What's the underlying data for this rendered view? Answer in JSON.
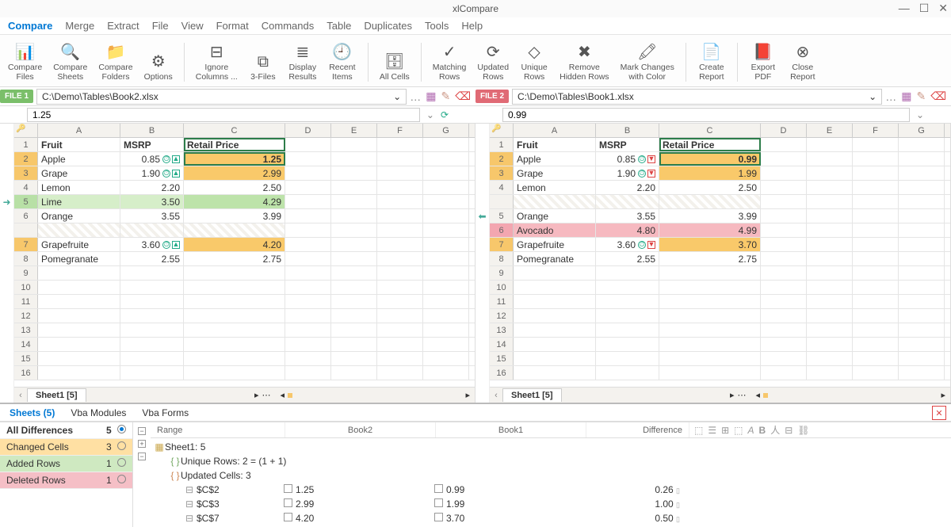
{
  "app": {
    "title": "xlCompare"
  },
  "menu": [
    "Compare",
    "Merge",
    "Extract",
    "File",
    "View",
    "Format",
    "Commands",
    "Table",
    "Duplicates",
    "Tools",
    "Help"
  ],
  "ribbon": [
    {
      "l1": "Compare",
      "l2": "Files"
    },
    {
      "l1": "Compare",
      "l2": "Sheets"
    },
    {
      "l1": "Compare",
      "l2": "Folders"
    },
    {
      "l1": "Options",
      "l2": ""
    },
    {
      "l1": "Ignore",
      "l2": "Columns ..."
    },
    {
      "l1": "3-Files",
      "l2": ""
    },
    {
      "l1": "Display",
      "l2": "Results"
    },
    {
      "l1": "Recent",
      "l2": "Items"
    },
    {
      "l1": "All Cells",
      "l2": ""
    },
    {
      "l1": "Matching",
      "l2": "Rows"
    },
    {
      "l1": "Updated",
      "l2": "Rows"
    },
    {
      "l1": "Unique",
      "l2": "Rows"
    },
    {
      "l1": "Remove",
      "l2": "Hidden Rows"
    },
    {
      "l1": "Mark Changes",
      "l2": "with Color"
    },
    {
      "l1": "Create",
      "l2": "Report"
    },
    {
      "l1": "Export",
      "l2": "PDF"
    },
    {
      "l1": "Close",
      "l2": "Report"
    }
  ],
  "files": {
    "left": {
      "badge": "FILE 1",
      "color": "#7bbf6a",
      "path": "C:\\Demo\\Tables\\Book2.xlsx",
      "formula": "1.25"
    },
    "right": {
      "badge": "FILE 2",
      "color": "#e06a75",
      "path": "C:\\Demo\\Tables\\Book1.xlsx",
      "formula": "0.99"
    }
  },
  "cols": [
    "A",
    "B",
    "C",
    "D",
    "E",
    "F",
    "G"
  ],
  "headers": [
    "Fruit",
    "MSRP",
    "Retail Price"
  ],
  "left_rows": [
    {
      "n": "1",
      "hdr": true
    },
    {
      "n": "2",
      "a": "Apple",
      "b": "0.85",
      "c": "1.25",
      "cls": "amber",
      "ind": "up",
      "sel": true
    },
    {
      "n": "3",
      "a": "Grape",
      "b": "1.90",
      "c": "2.99",
      "cls": "amber",
      "ind": "up"
    },
    {
      "n": "4",
      "a": "Lemon",
      "b": "2.20",
      "c": "2.50"
    },
    {
      "n": "5",
      "a": "Lime",
      "b": "3.50",
      "c": "4.29",
      "cls": "green"
    },
    {
      "n": "6",
      "a": "Orange",
      "b": "3.55",
      "c": "3.99"
    },
    {
      "n": "",
      "dash": true
    },
    {
      "n": "7",
      "a": "Grapefruite",
      "b": "3.60",
      "c": "4.20",
      "cls": "amber",
      "ind": "up"
    },
    {
      "n": "8",
      "a": "Pomegranate",
      "b": "2.55",
      "c": "2.75"
    },
    {
      "n": "9"
    },
    {
      "n": "10"
    },
    {
      "n": "11"
    },
    {
      "n": "12"
    },
    {
      "n": "13"
    },
    {
      "n": "14"
    },
    {
      "n": "15"
    },
    {
      "n": "16"
    }
  ],
  "right_rows": [
    {
      "n": "1",
      "hdr": true
    },
    {
      "n": "2",
      "a": "Apple",
      "b": "0.85",
      "c": "0.99",
      "cls": "amber",
      "ind": "dn",
      "sel": true
    },
    {
      "n": "3",
      "a": "Grape",
      "b": "1.90",
      "c": "1.99",
      "cls": "amber",
      "ind": "dn"
    },
    {
      "n": "4",
      "a": "Lemon",
      "b": "2.20",
      "c": "2.50"
    },
    {
      "n": "",
      "dash": true
    },
    {
      "n": "5",
      "a": "Orange",
      "b": "3.55",
      "c": "3.99"
    },
    {
      "n": "6",
      "a": "Avocado",
      "b": "4.80",
      "c": "4.99",
      "cls": "pink"
    },
    {
      "n": "7",
      "a": "Grapefruite",
      "b": "3.60",
      "c": "3.70",
      "cls": "amber",
      "ind": "dn"
    },
    {
      "n": "8",
      "a": "Pomegranate",
      "b": "2.55",
      "c": "2.75"
    },
    {
      "n": "9"
    },
    {
      "n": "10"
    },
    {
      "n": "11"
    },
    {
      "n": "12"
    },
    {
      "n": "13"
    },
    {
      "n": "14"
    },
    {
      "n": "15"
    },
    {
      "n": "16"
    }
  ],
  "sheet_tab": "Sheet1 [5]",
  "panel_tabs": [
    "Sheets (5)",
    "Vba Modules",
    "Vba Forms"
  ],
  "diffside": [
    {
      "label": "All Differences",
      "count": "5",
      "cls": "hdr",
      "on": true
    },
    {
      "label": "Changed Cells",
      "count": "3",
      "cls": "amber"
    },
    {
      "label": "Added Rows",
      "count": "1",
      "cls": "green"
    },
    {
      "label": "Deleted Rows",
      "count": "1",
      "cls": "pink"
    }
  ],
  "diffcols": [
    "Range",
    "Book2",
    "Book1",
    "Difference"
  ],
  "difftree": {
    "root": "Sheet1: 5",
    "unique": "Unique Rows: 2 = (1 + 1)",
    "updated": "Updated Cells: 3",
    "rows": [
      {
        "range": "$C$2",
        "b2": "1.25",
        "b1": "0.99",
        "diff": "0.26"
      },
      {
        "range": "$C$3",
        "b2": "2.99",
        "b1": "1.99",
        "diff": "1.00"
      },
      {
        "range": "$C$7",
        "b2": "4.20",
        "b1": "3.70",
        "diff": "0.50"
      }
    ]
  }
}
